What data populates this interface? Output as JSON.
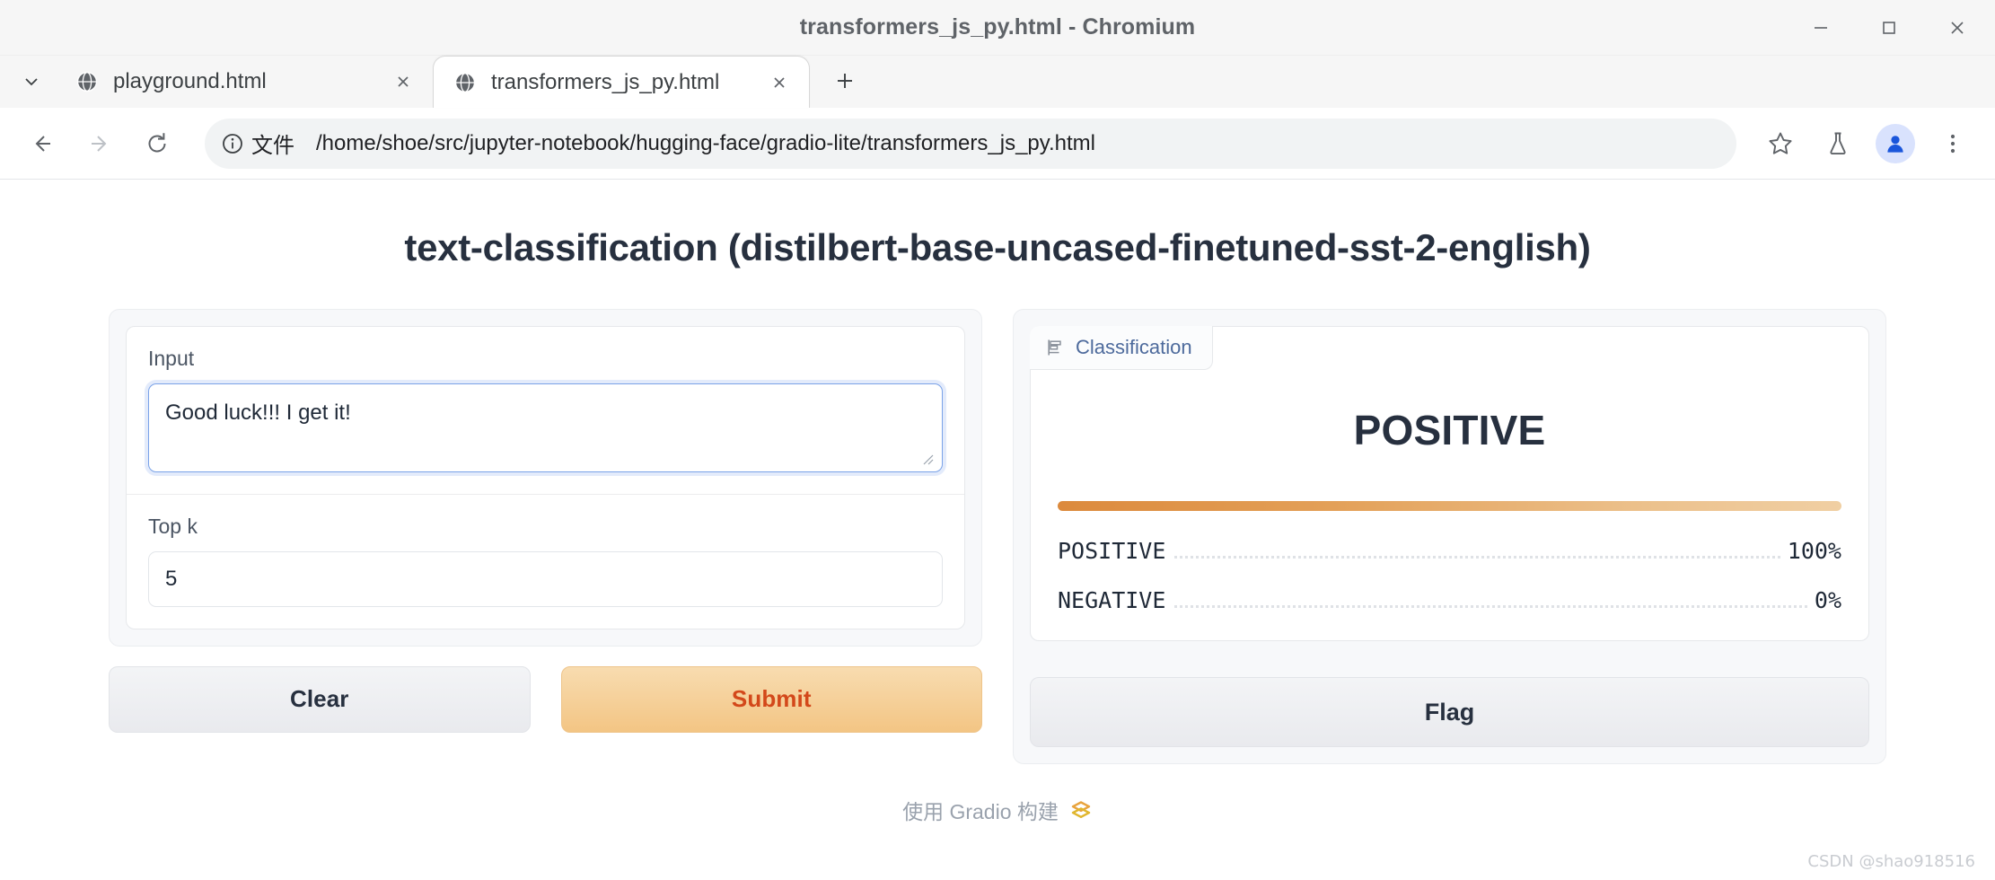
{
  "window": {
    "title": "transformers_js_py.html - Chromium",
    "minimize_label": "Minimize",
    "maximize_label": "Maximize",
    "close_label": "Close"
  },
  "tabs": {
    "list_button_name": "tab-search-chevron",
    "items": [
      {
        "title": "playground.html",
        "active": false,
        "favicon": "globe-icon",
        "close_label": "×"
      },
      {
        "title": "transformers_js_py.html",
        "active": true,
        "favicon": "globe-icon",
        "close_label": "×"
      }
    ],
    "new_tab_label": "+"
  },
  "toolbar": {
    "back_label": "Back",
    "forward_label": "Forward",
    "reload_label": "Reload",
    "security_chip": "文件",
    "url": "/home/shoe/src/jupyter-notebook/hugging-face/gradio-lite/transformers_js_py.html",
    "bookmark_label": "Bookmark this tab",
    "flask_label": "Experiments",
    "profile_label": "Profile",
    "menu_label": "Customize and control Chromium"
  },
  "app": {
    "title": "text-classification (distilbert-base-uncased-finetuned-sst-2-english)",
    "input": {
      "label": "Input",
      "value": "Good luck!!! I get it!",
      "placeholder": ""
    },
    "topk": {
      "label": "Top k",
      "value": "5",
      "placeholder": ""
    },
    "buttons": {
      "clear": "Clear",
      "submit": "Submit",
      "flag": "Flag"
    },
    "output": {
      "tag_label": "Classification",
      "tag_icon": "bar-chart-icon",
      "top_label": "POSITIVE"
    },
    "footer": {
      "text": "使用 Gradio 构建",
      "logo": "gradio-logo-icon"
    }
  },
  "watermark": "CSDN @shao918516",
  "colors": {
    "primary_accent": "#d3481a",
    "submit_gradient_start": "#f8dcb0",
    "submit_gradient_end": "#f3c584",
    "bar_gradient_start": "#dc8a3d",
    "bar_gradient_end": "#f0cfa3",
    "focus_border": "#7ba3e8",
    "heading": "#27303f"
  },
  "chart_data": {
    "type": "bar",
    "title": "Classification",
    "categories": [
      "POSITIVE",
      "NEGATIVE"
    ],
    "values": [
      100,
      0
    ],
    "value_labels": [
      "100%",
      "0%"
    ],
    "xlabel": "",
    "ylabel": "",
    "ylim": [
      0,
      100
    ],
    "unit": "%",
    "grid": false,
    "legend": "none",
    "top_prediction": "POSITIVE"
  }
}
